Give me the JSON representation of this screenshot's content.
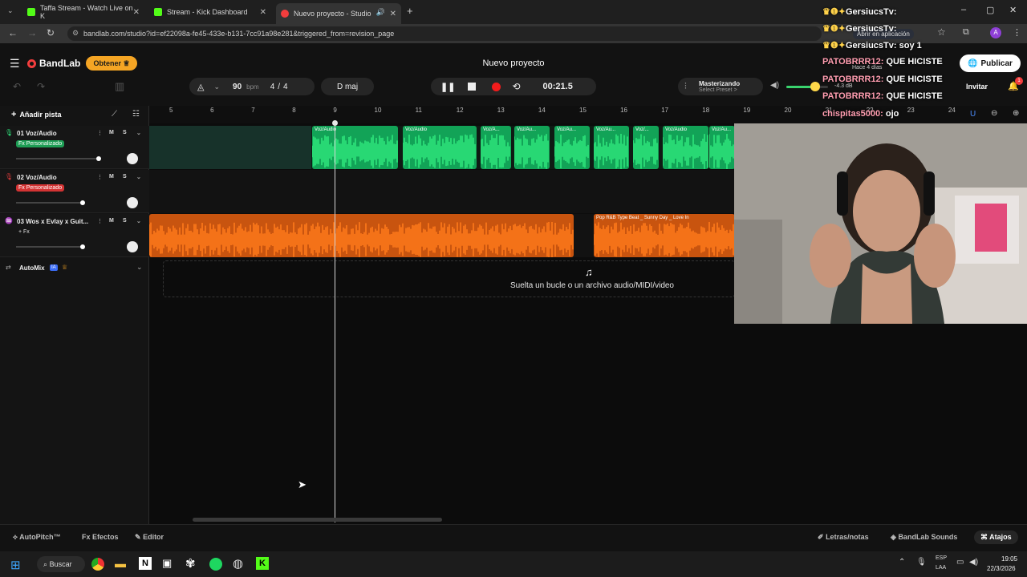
{
  "browser": {
    "tabs": [
      {
        "label": "Taffa Stream - Watch Live on K",
        "color": "#53fc18"
      },
      {
        "label": "Stream - Kick Dashboard",
        "color": "#53fc18"
      },
      {
        "label": "Nuevo proyecto - Studio",
        "color": "#f23d3d"
      }
    ],
    "url": "bandlab.com/studio?id=ef22098a-fe45-433e-b131-7cc91a98e281&triggered_from=revision_page",
    "open_in_app": "Abrir en aplicación"
  },
  "app": {
    "brand": "BandLab",
    "obtener": "Obtener",
    "project_title": "Nuevo proyecto",
    "publish": "Publicar",
    "invite": "Invitar",
    "bpm_value": "90",
    "bpm_unit": "bpm",
    "time_sig_num": "4",
    "time_sig_sep": "/",
    "time_sig_den": "4",
    "key": "D maj",
    "time_display": "00:21.5",
    "mastering_title": "Masterizando",
    "mastering_preset": "Select Preset >",
    "volume_db": "-4.3 dB",
    "notification_count": "1"
  },
  "timeline": {
    "add_track": "Añadir pista",
    "ruler": [
      "5",
      "6",
      "7",
      "8",
      "9",
      "10",
      "11",
      "12",
      "13",
      "14",
      "15",
      "16",
      "17",
      "18",
      "19",
      "20",
      "21",
      "22",
      "23",
      "24"
    ],
    "drop_hint": "Suelta un bucle o un archivo audio/MIDI/video",
    "automix": "AutoMix",
    "automix_badge": "IA"
  },
  "tracks": [
    {
      "name": "01  Voz/Audio",
      "fx": "Fx Personalizado",
      "fx_color": "#2dbf6a",
      "color": "#2ee67c",
      "clips": [
        {
          "label": "Voz/Audio"
        },
        {
          "label": "Voz/Audio"
        },
        {
          "label": "Voz/A..."
        },
        {
          "label": "Voz/Au..."
        },
        {
          "label": "Voz/Au..."
        },
        {
          "label": "Voz/Au..."
        },
        {
          "label": "Voz/..."
        },
        {
          "label": "Voz/Audio"
        },
        {
          "label": "Voz/Au..."
        }
      ]
    },
    {
      "name": "02  Voz/Audio",
      "fx": "Fx Personalizado",
      "fx_color": "#e03c3c",
      "color": "#e03c3c",
      "clips": []
    },
    {
      "name": "03  Wos x Evlay x Guit...",
      "fx": "+ Fx",
      "fx_color": "transparent",
      "color": "#ff7a1a",
      "clips": [
        {
          "label": ""
        },
        {
          "label": "Pop R&B Type Beat _ Sunny Day _ Love In"
        }
      ]
    }
  ],
  "track_buttons": {
    "mute": "M",
    "solo": "S"
  },
  "footer": {
    "autopitch": "AutoPitch™",
    "effects": "Efectos",
    "editor": "Editor",
    "lyrics": "Letras/notas",
    "sounds": "BandLab Sounds",
    "shortcuts": "Atajos"
  },
  "chat": [
    {
      "user": "GersiucsTv:",
      "msg": ""
    },
    {
      "user": "GersiucsTv:",
      "msg": ""
    },
    {
      "user": "GersiucsTv:",
      "msg": "soy 1"
    },
    {
      "user": "PATOBRRR12:",
      "msg": "QUE HICISTE"
    },
    {
      "user": "PATOBRRR12:",
      "msg": "QUE HICISTE"
    },
    {
      "user": "PATOBRRR12:",
      "msg": "QUE HICISTE"
    },
    {
      "user": "chispitas5000:",
      "msg": "ojo"
    }
  ],
  "chat_meta": "Hace 4 días",
  "taskbar": {
    "search": "Buscar",
    "lang_top": "ESP",
    "lang_bottom": "LAA",
    "time": "19:05",
    "date": "22/3/2026"
  }
}
